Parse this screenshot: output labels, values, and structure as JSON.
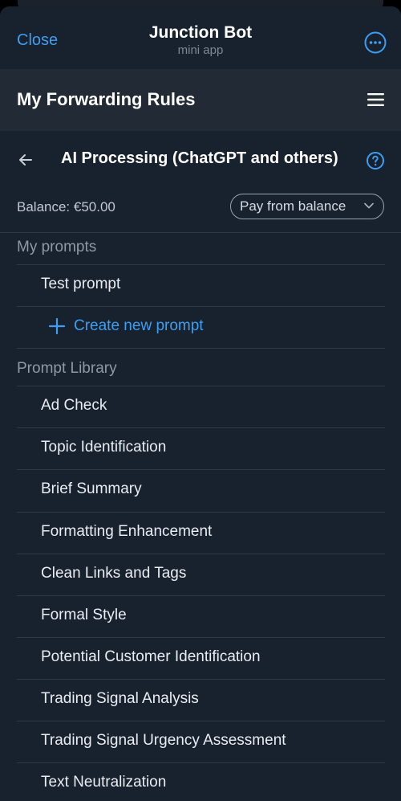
{
  "telegram_header": {
    "close_label": "Close",
    "title": "Junction Bot",
    "subtitle": "mini app",
    "more_icon": "ellipsis-circle-icon"
  },
  "page_header": {
    "title": "My Forwarding Rules",
    "menu_icon": "hamburger-menu-icon"
  },
  "section": {
    "back_icon": "arrow-left-icon",
    "title": "AI Processing (ChatGPT and others)",
    "help_icon": "question-circle-icon"
  },
  "balance": {
    "text": "Balance: €50.00",
    "payment_select": {
      "selected": "Pay from balance",
      "icon": "chevron-down-icon"
    }
  },
  "my_prompts": {
    "label": "My prompts",
    "items": [
      {
        "label": "Test prompt"
      }
    ],
    "create": {
      "label": "Create new prompt",
      "icon": "plus-icon"
    }
  },
  "prompt_library": {
    "label": "Prompt Library",
    "items": [
      {
        "label": "Ad Check"
      },
      {
        "label": "Topic Identification"
      },
      {
        "label": "Brief Summary"
      },
      {
        "label": "Formatting Enhancement"
      },
      {
        "label": "Clean Links and Tags"
      },
      {
        "label": "Formal Style"
      },
      {
        "label": "Potential Customer Identification"
      },
      {
        "label": "Trading Signal Analysis"
      },
      {
        "label": "Trading Signal Urgency Assessment"
      },
      {
        "label": "Text Neutralization"
      }
    ]
  },
  "colors": {
    "accent": "#3e9ef2",
    "background": "#18222f",
    "header_background": "#212a35",
    "separator": "#2f3a47",
    "muted_text": "#8f99a5"
  }
}
